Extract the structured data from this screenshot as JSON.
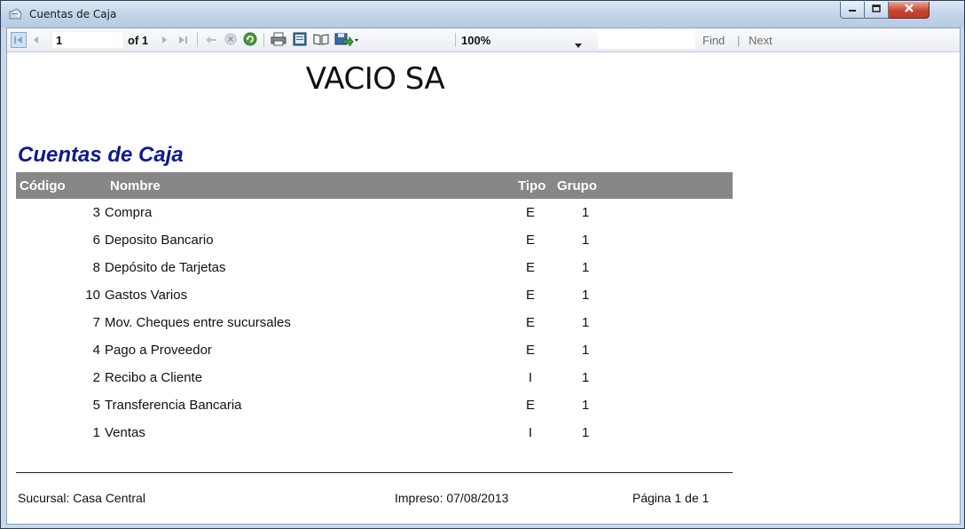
{
  "window": {
    "title": "Cuentas de Caja",
    "app_icon": "report-viewer-icon"
  },
  "toolbar": {
    "current_page": "1",
    "of_label": "of 1",
    "zoom": "100%",
    "find_label": "Find",
    "find_separator": "|",
    "next_label": "Next"
  },
  "report": {
    "company": "VACIO SA",
    "title": "Cuentas de Caja",
    "headers": {
      "codigo": "Código",
      "nombre": "Nombre",
      "tipo": "Tipo",
      "grupo": "Grupo"
    },
    "rows": [
      {
        "codigo": "3",
        "nombre": "Compra",
        "tipo": "E",
        "grupo": "1"
      },
      {
        "codigo": "6",
        "nombre": "Deposito Bancario",
        "tipo": "E",
        "grupo": "1"
      },
      {
        "codigo": "8",
        "nombre": "Depósito de Tarjetas",
        "tipo": "E",
        "grupo": "1"
      },
      {
        "codigo": "10",
        "nombre": "Gastos Varios",
        "tipo": "E",
        "grupo": "1"
      },
      {
        "codigo": "7",
        "nombre": "Mov. Cheques entre sucursales",
        "tipo": "E",
        "grupo": "1"
      },
      {
        "codigo": "4",
        "nombre": "Pago a Proveedor",
        "tipo": "E",
        "grupo": "1"
      },
      {
        "codigo": "2",
        "nombre": "Recibo a Cliente",
        "tipo": "I",
        "grupo": "1"
      },
      {
        "codigo": "5",
        "nombre": "Transferencia Bancaria",
        "tipo": "E",
        "grupo": "1"
      },
      {
        "codigo": "1",
        "nombre": "Ventas",
        "tipo": "I",
        "grupo": "1"
      }
    ],
    "footer": {
      "sucursal": "Sucursal: Casa Central",
      "impreso": "Impreso: 07/08/2013",
      "pagina": "Página 1 de 1"
    }
  },
  "colors": {
    "title_blue": "#0e1a8c",
    "header_gray": "#878787",
    "close_red": "#c6452f"
  }
}
